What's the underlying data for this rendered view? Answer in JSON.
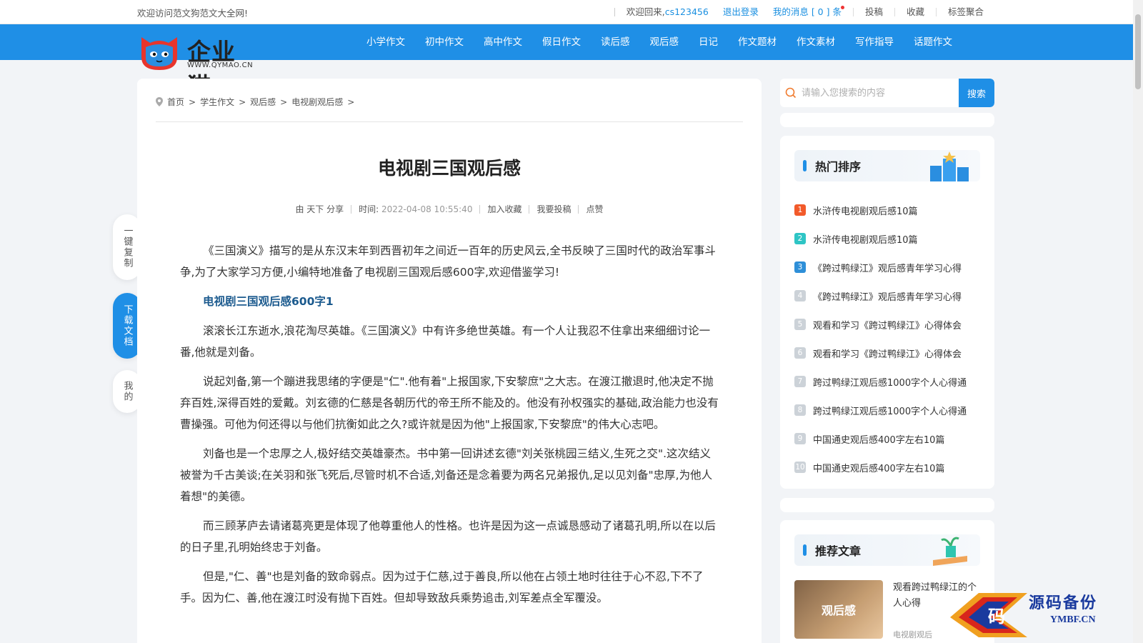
{
  "topbar": {
    "welcome_site": "欢迎访问范文狗范文大全网!",
    "welcome_back": "欢迎回来,",
    "username": "cs123456",
    "logout": "退出登录",
    "messages": "我的消息 [ 0 ] 条",
    "submit": "投稿",
    "favorite": "收藏",
    "tags": "标签聚合"
  },
  "logo": {
    "name": "企业猫",
    "url": "WWW.QYMAO.CN"
  },
  "nav": [
    "小学作文",
    "初中作文",
    "高中作文",
    "假日作文",
    "读后感",
    "观后感",
    "日记",
    "作文题材",
    "作文素材",
    "写作指导",
    "话题作文"
  ],
  "breadcrumb": [
    "首页",
    "学生作文",
    "观后感",
    "电视剧观后感"
  ],
  "article": {
    "title": "电视剧三国观后感",
    "author": "由 天下 分享",
    "time_label": "时间:",
    "time": "2022-04-08 10:55:40",
    "add_fav": "加入收藏",
    "contribute": "我要投稿",
    "like": "点赞",
    "intro": "《三国演义》描写的是从东汉末年到西晋初年之间近一百年的历史风云,全书反映了三国时代的政治军事斗争,为了大家学习方便,小编特地准备了电视剧三国观后感600字,欢迎借鉴学习!",
    "subtitle": "电视剧三国观后感600字1",
    "paragraphs": [
      "滚滚长江东逝水,浪花淘尽英雄。《三国演义》中有许多绝世英雄。有一个人让我忍不住拿出来细细讨论一番,他就是刘备。",
      "说起刘备,第一个蹦进我思绪的字便是\"仁\".他有着\"上报国家,下安黎庶\"之大志。在渡江撤退时,他决定不抛弃百姓,深得百姓的爱戴。刘玄德的仁慈是各朝历代的帝王所不能及的。他没有孙权强实的基础,政治能力也没有曹操强。可他为何还得以与他们抗衡如此之久?或许就是因为他\"上报国家,下安黎庶\"的伟大心志吧。",
      "刘备也是一个忠厚之人,极好结交英雄豪杰。书中第一回讲述玄德\"刘关张桃园三结义,生死之交\".这次结义被誉为千古美谈;在关羽和张飞死后,尽管时机不合适,刘备还是念着要为两名兄弟报仇,足以见刘备\"忠厚,为他人着想\"的美德。",
      "而三顾茅庐去请诸葛亮更是体现了他尊重他人的性格。也许是因为这一点诚恳感动了诸葛孔明,所以在以后的日子里,孔明始终忠于刘备。",
      "但是,\"仁、善\"也是刘备的致命弱点。因为过于仁慈,过于善良,所以他在占领土地时往往于心不忍,下不了手。因为仁、善,他在渡江时没有抛下百姓。但却导致敌兵乘势追击,刘军差点全军覆没。"
    ]
  },
  "float_tools": {
    "copy": "一键复制",
    "download": "下载文档",
    "mine": "我的"
  },
  "search": {
    "placeholder": "请输入您搜索的内容",
    "button": "搜索"
  },
  "hot": {
    "title": "热门排序",
    "items": [
      "水浒传电视剧观后感10篇",
      "水浒传电视剧观后感10篇",
      "《跨过鸭绿江》观后感青年学习心得",
      "《跨过鸭绿江》观后感青年学习心得",
      "观看和学习《跨过鸭绿江》心得体会",
      "观看和学习《跨过鸭绿江》心得体会",
      "跨过鸭绿江观后感1000字个人心得通",
      "跨过鸭绿江观后感1000字个人心得通",
      "中国通史观后感400字左右10篇",
      "中国通史观后感400字左右10篇"
    ]
  },
  "recommend": {
    "title": "推荐文章",
    "thumb_text": "观后感",
    "item_title": "观看跨过鸭绿江的个人心得",
    "item_sub": "电视剧观后"
  },
  "watermark": {
    "text": "源码备份",
    "url": "YMBF.CN",
    "badge": "码"
  },
  "colors": {
    "brand": "#1f8fe6",
    "link": "#1a8fe0",
    "subtitle": "#1b5a8e"
  }
}
